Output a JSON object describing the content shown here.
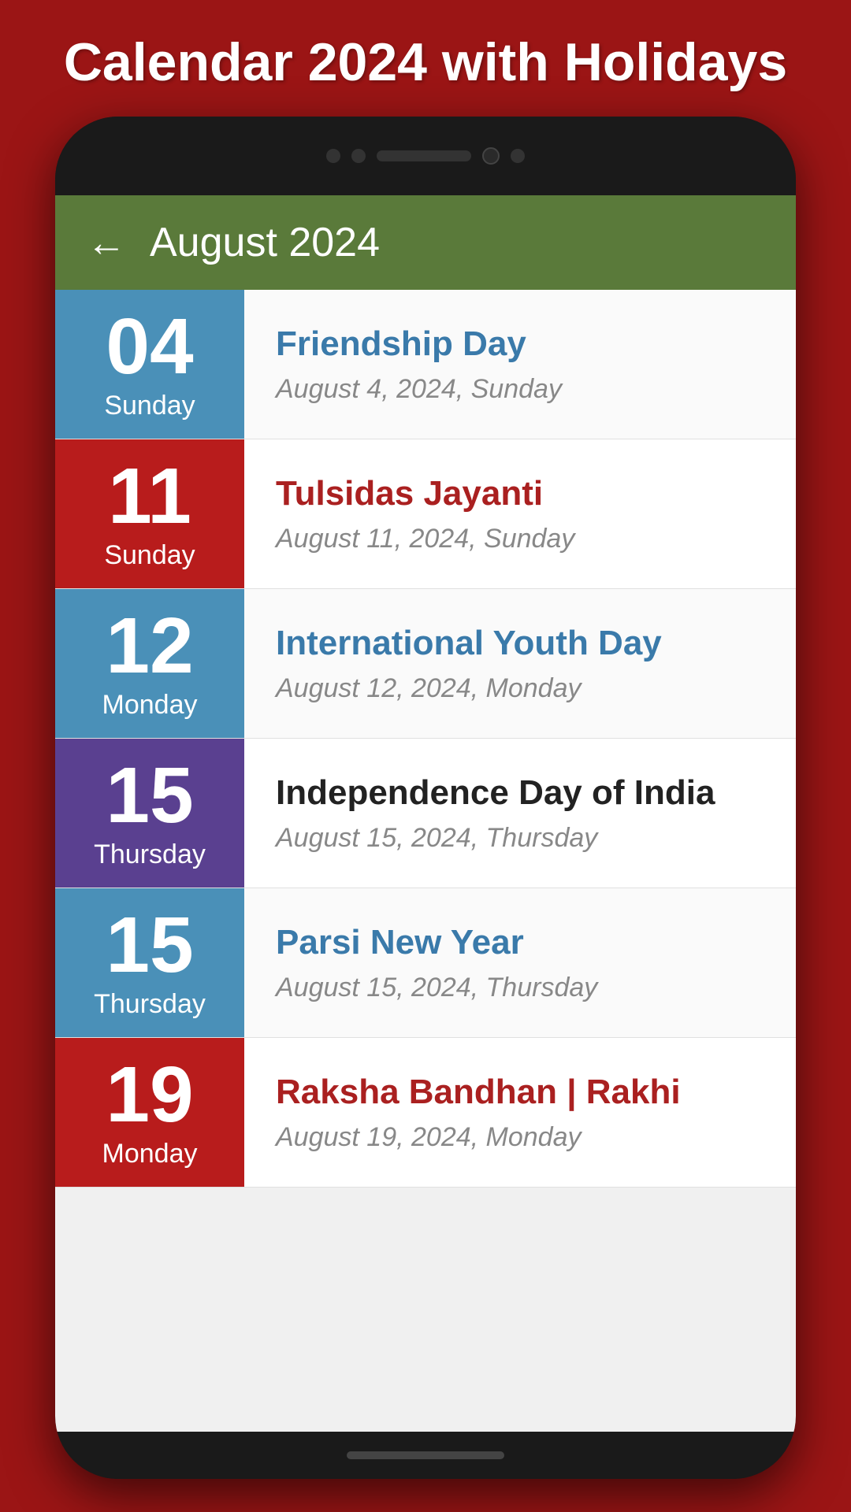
{
  "page": {
    "title": "Calendar 2024 with Holidays",
    "header": {
      "back_label": "←",
      "month_title": "August 2024"
    },
    "events": [
      {
        "date_number": "04",
        "date_day": "Sunday",
        "badge_color": "blue",
        "event_name": "Friendship Day",
        "event_name_color": "blue-text",
        "event_date": "August 4, 2024, Sunday"
      },
      {
        "date_number": "11",
        "date_day": "Sunday",
        "badge_color": "red",
        "event_name": "Tulsidas Jayanti",
        "event_name_color": "red-text",
        "event_date": "August 11, 2024, Sunday"
      },
      {
        "date_number": "12",
        "date_day": "Monday",
        "badge_color": "blue",
        "event_name": "International Youth Day",
        "event_name_color": "blue-text",
        "event_date": "August 12, 2024, Monday"
      },
      {
        "date_number": "15",
        "date_day": "Thursday",
        "badge_color": "purple",
        "event_name": "Independence Day of India",
        "event_name_color": "dark-text",
        "event_date": "August 15, 2024, Thursday"
      },
      {
        "date_number": "15",
        "date_day": "Thursday",
        "badge_color": "blue",
        "event_name": "Parsi New Year",
        "event_name_color": "blue-text",
        "event_date": "August 15, 2024, Thursday"
      },
      {
        "date_number": "19",
        "date_day": "Monday",
        "badge_color": "red",
        "event_name": "Raksha Bandhan | Rakhi",
        "event_name_color": "red-text",
        "event_date": "August 19, 2024, Monday"
      }
    ]
  }
}
